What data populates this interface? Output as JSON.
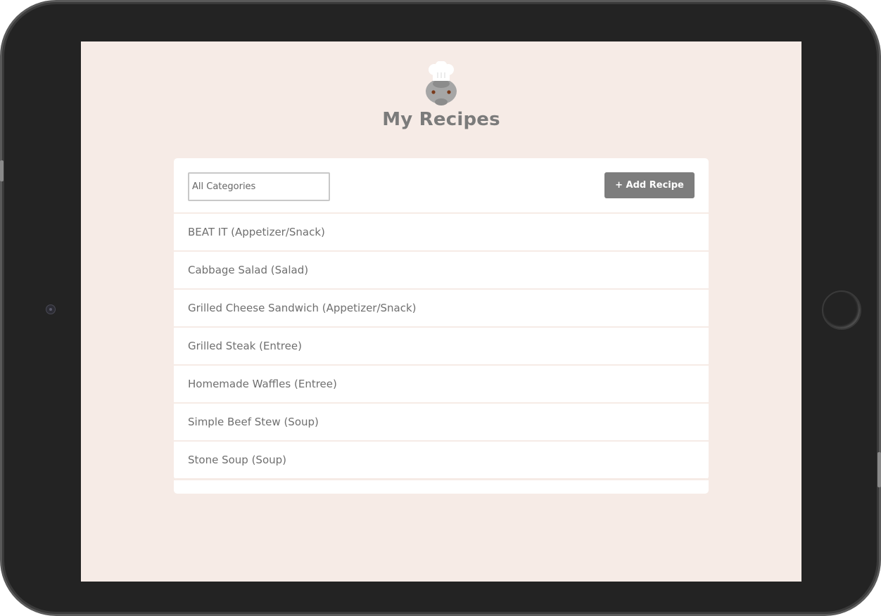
{
  "app": {
    "title": "My Recipes"
  },
  "toolbar": {
    "category_filter": {
      "selected": "All Categories",
      "options": [
        "All Categories"
      ]
    },
    "add_label": "+ Add Recipe"
  },
  "recipes": [
    "BEAT IT (Appetizer/Snack)",
    "Cabbage Salad (Salad)",
    "Grilled Cheese Sandwich (Appetizer/Snack)",
    "Grilled Steak (Entree)",
    "Homemade Waffles (Entree)",
    "Simple Beef Stew (Soup)",
    "Stone Soup (Soup)"
  ],
  "colors": {
    "screen_background": "#f6ebe6",
    "panel_background": "#ffffff",
    "title_text": "#7b7b7b",
    "button_background": "#7d7d7d",
    "device_bezel": "#232323"
  },
  "icons": {
    "logo": "chef-hat-logo-icon"
  }
}
